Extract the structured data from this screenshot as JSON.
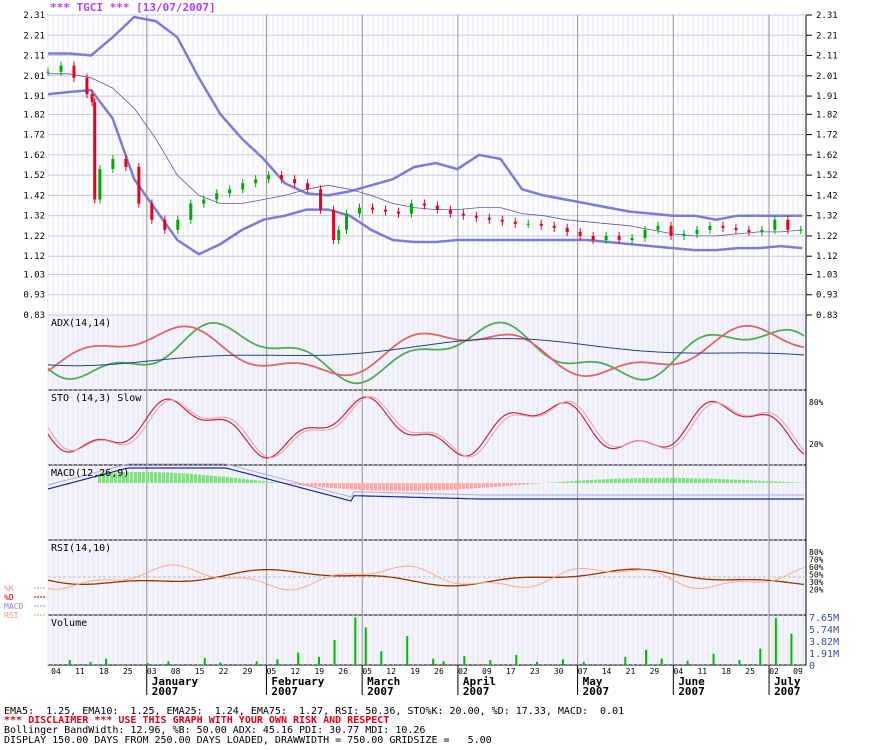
{
  "chart_data": {
    "type": "candlestick",
    "title": "*** TGCI *** [13/07/2007]",
    "price_ticks": [
      "2.31",
      "2.21",
      "2.11",
      "2.01",
      "1.91",
      "1.82",
      "1.72",
      "1.62",
      "1.52",
      "1.42",
      "1.32",
      "1.22",
      "1.12",
      "1.03",
      "0.93",
      "0.83"
    ],
    "price_range": [
      0.83,
      2.31
    ],
    "day_ticks": [
      "04",
      "11",
      "18",
      "25",
      "03",
      "08",
      "15",
      "22",
      "29",
      "05",
      "12",
      "19",
      "26",
      "05",
      "12",
      "19",
      "26",
      "02",
      "09",
      "17",
      "23",
      "30",
      "07",
      "14",
      "21",
      "29",
      "04",
      "11",
      "18",
      "25",
      "02",
      "09"
    ],
    "months": [
      {
        "name": "January",
        "year": "2007"
      },
      {
        "name": "February",
        "year": "2007"
      },
      {
        "name": "March",
        "year": "2007"
      },
      {
        "name": "April",
        "year": "2007"
      },
      {
        "name": "May",
        "year": "2007"
      },
      {
        "name": "June",
        "year": "2007"
      },
      {
        "name": "July",
        "year": "2007"
      }
    ],
    "price_series": [
      {
        "day": 0,
        "close": 2.03
      },
      {
        "day": 5,
        "close": 2.06
      },
      {
        "day": 10,
        "close": 2.0
      },
      {
        "day": 15,
        "close": 1.92
      },
      {
        "day": 17,
        "close": 1.88
      },
      {
        "day": 18,
        "close": 1.4
      },
      {
        "day": 20,
        "close": 1.55
      },
      {
        "day": 25,
        "close": 1.6
      },
      {
        "day": 30,
        "close": 1.56
      },
      {
        "day": 35,
        "close": 1.38
      },
      {
        "day": 40,
        "close": 1.3
      },
      {
        "day": 45,
        "close": 1.25
      },
      {
        "day": 50,
        "close": 1.3
      },
      {
        "day": 55,
        "close": 1.38
      },
      {
        "day": 60,
        "close": 1.4
      },
      {
        "day": 65,
        "close": 1.43
      },
      {
        "day": 70,
        "close": 1.45
      },
      {
        "day": 75,
        "close": 1.48
      },
      {
        "day": 80,
        "close": 1.5
      },
      {
        "day": 85,
        "close": 1.52
      },
      {
        "day": 90,
        "close": 1.5
      },
      {
        "day": 95,
        "close": 1.48
      },
      {
        "day": 100,
        "close": 1.45
      },
      {
        "day": 105,
        "close": 1.35
      },
      {
        "day": 110,
        "close": 1.2
      },
      {
        "day": 112,
        "close": 1.25
      },
      {
        "day": 115,
        "close": 1.33
      },
      {
        "day": 120,
        "close": 1.36
      },
      {
        "day": 125,
        "close": 1.35
      },
      {
        "day": 130,
        "close": 1.34
      },
      {
        "day": 135,
        "close": 1.33
      },
      {
        "day": 140,
        "close": 1.38
      },
      {
        "day": 145,
        "close": 1.37
      },
      {
        "day": 150,
        "close": 1.35
      },
      {
        "day": 155,
        "close": 1.33
      },
      {
        "day": 160,
        "close": 1.32
      },
      {
        "day": 165,
        "close": 1.31
      },
      {
        "day": 170,
        "close": 1.3
      },
      {
        "day": 175,
        "close": 1.29
      },
      {
        "day": 180,
        "close": 1.28
      },
      {
        "day": 185,
        "close": 1.28
      },
      {
        "day": 190,
        "close": 1.27
      },
      {
        "day": 195,
        "close": 1.26
      },
      {
        "day": 200,
        "close": 1.24
      },
      {
        "day": 205,
        "close": 1.22
      },
      {
        "day": 210,
        "close": 1.2
      },
      {
        "day": 215,
        "close": 1.22
      },
      {
        "day": 220,
        "close": 1.2
      },
      {
        "day": 225,
        "close": 1.21
      },
      {
        "day": 230,
        "close": 1.25
      },
      {
        "day": 235,
        "close": 1.27
      },
      {
        "day": 240,
        "close": 1.22
      },
      {
        "day": 245,
        "close": 1.23
      },
      {
        "day": 250,
        "close": 1.25
      },
      {
        "day": 255,
        "close": 1.27
      },
      {
        "day": 260,
        "close": 1.26
      },
      {
        "day": 265,
        "close": 1.25
      },
      {
        "day": 270,
        "close": 1.24
      },
      {
        "day": 275,
        "close": 1.25
      },
      {
        "day": 280,
        "close": 1.3
      },
      {
        "day": 285,
        "close": 1.25
      },
      {
        "day": 290,
        "close": 1.25
      }
    ],
    "bollinger_upper": [
      2.12,
      2.12,
      2.11,
      2.2,
      2.3,
      2.28,
      2.2,
      2.0,
      1.82,
      1.7,
      1.6,
      1.48,
      1.43,
      1.42,
      1.44,
      1.47,
      1.5,
      1.56,
      1.58,
      1.55,
      1.62,
      1.6,
      1.45,
      1.42,
      1.4,
      1.38,
      1.36,
      1.34,
      1.33,
      1.32,
      1.32,
      1.3,
      1.32,
      1.32,
      1.32,
      1.32
    ],
    "bollinger_lower": [
      1.92,
      1.93,
      1.94,
      1.8,
      1.5,
      1.35,
      1.2,
      1.13,
      1.18,
      1.25,
      1.3,
      1.32,
      1.35,
      1.35,
      1.32,
      1.25,
      1.2,
      1.19,
      1.19,
      1.2,
      1.2,
      1.2,
      1.2,
      1.2,
      1.2,
      1.2,
      1.19,
      1.18,
      1.17,
      1.16,
      1.15,
      1.15,
      1.16,
      1.16,
      1.17,
      1.16
    ],
    "sma": [
      2.02,
      2.02,
      2.0,
      1.95,
      1.85,
      1.7,
      1.52,
      1.42,
      1.38,
      1.38,
      1.4,
      1.42,
      1.45,
      1.47,
      1.45,
      1.42,
      1.38,
      1.36,
      1.35,
      1.35,
      1.36,
      1.36,
      1.33,
      1.32,
      1.3,
      1.29,
      1.28,
      1.27,
      1.25,
      1.23,
      1.22,
      1.22,
      1.23,
      1.24,
      1.24,
      1.25
    ],
    "volume_labels": [
      "7.65M",
      "5.74M",
      "3.82M",
      "1.91M",
      "0"
    ],
    "volume_max": 7.65,
    "volume_bars": [
      {
        "day": 8,
        "v": 0.8
      },
      {
        "day": 16,
        "v": 0.5
      },
      {
        "day": 22,
        "v": 1.0
      },
      {
        "day": 38,
        "v": 0.3
      },
      {
        "day": 46,
        "v": 0.6
      },
      {
        "day": 60,
        "v": 1.1
      },
      {
        "day": 66,
        "v": 0.4
      },
      {
        "day": 80,
        "v": 0.6
      },
      {
        "day": 88,
        "v": 0.9
      },
      {
        "day": 96,
        "v": 2.0
      },
      {
        "day": 104,
        "v": 1.3
      },
      {
        "day": 110,
        "v": 4.0
      },
      {
        "day": 118,
        "v": 7.6
      },
      {
        "day": 122,
        "v": 6.0
      },
      {
        "day": 128,
        "v": 2.2
      },
      {
        "day": 138,
        "v": 4.6
      },
      {
        "day": 148,
        "v": 1.0
      },
      {
        "day": 152,
        "v": 0.6
      },
      {
        "day": 160,
        "v": 1.4
      },
      {
        "day": 170,
        "v": 0.8
      },
      {
        "day": 180,
        "v": 1.6
      },
      {
        "day": 188,
        "v": 0.5
      },
      {
        "day": 198,
        "v": 0.9
      },
      {
        "day": 206,
        "v": 0.5
      },
      {
        "day": 222,
        "v": 1.3
      },
      {
        "day": 230,
        "v": 2.4
      },
      {
        "day": 236,
        "v": 1.0
      },
      {
        "day": 246,
        "v": 0.7
      },
      {
        "day": 256,
        "v": 1.8
      },
      {
        "day": 266,
        "v": 0.8
      },
      {
        "day": 274,
        "v": 2.6
      },
      {
        "day": 280,
        "v": 7.5
      },
      {
        "day": 286,
        "v": 5.0
      }
    ],
    "indicator_panels": [
      {
        "label": "ADX(14,14)"
      },
      {
        "label": "STO (14,3) Slow",
        "levels": [
          "80%",
          "20%"
        ]
      },
      {
        "label": "MACD(12,26,9)"
      },
      {
        "label": "RSI(14,10)",
        "levels": [
          "80%",
          "70%",
          "60%",
          "50%",
          "30%",
          "20%"
        ]
      },
      {
        "label": "Volume"
      }
    ],
    "legend": [
      "%K",
      "%D",
      "MACD",
      "RSI"
    ],
    "legend_colors": [
      "#ff8c8c",
      "#cc0000",
      "#8888ff",
      "#ff9966"
    ],
    "colors": {
      "up": "#00aa00",
      "down": "#e8001c",
      "band": "#7c7cd8",
      "sma": "#5a5aaa",
      "grid": "#c8c8e8"
    }
  },
  "footer": {
    "line1": "EMA5:  1.25, EMA10:  1.25, EMA25:  1.24, EMA75:  1.27, RSI: 50.36, STO%K: 20.00, %D: 17.33, MACD:  0.01",
    "line2": "*** DISCLAIMER *** USE THIS GRAPH WITH YOUR OWN RISK AND RESPECT",
    "line3": "Bollinger BandWidth: 12.96, %B: 50.00 ADX: 45.16 PDI: 30.77 MDI: 10.26",
    "line4": "DISPLAY 150.00 DAYS FROM 250.00 DAYS LOADED, DRAWWIDTH = 750.00 GRIDSIZE =   5.00"
  }
}
